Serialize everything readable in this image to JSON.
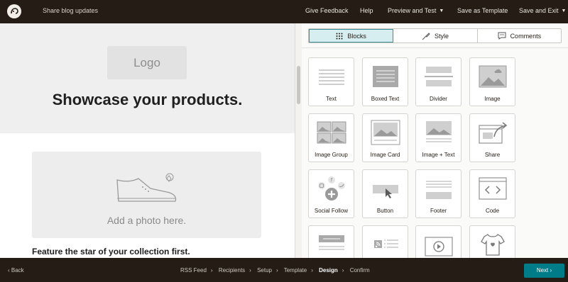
{
  "topbar": {
    "title": "Share blog updates",
    "nav": {
      "feedback": "Give Feedback",
      "help": "Help",
      "preview": "Preview and Test",
      "save_template": "Save as Template",
      "save_exit": "Save and Exit"
    }
  },
  "canvas": {
    "logo_placeholder": "Logo",
    "headline": "Showcase your products.",
    "photo_placeholder": "Add a photo here.",
    "feature_text": "Feature the star of your collection first."
  },
  "panel": {
    "tabs": [
      {
        "label": "Blocks",
        "icon": "grid-icon",
        "active": true
      },
      {
        "label": "Style",
        "icon": "brush-icon",
        "active": false
      },
      {
        "label": "Comments",
        "icon": "comment-icon",
        "active": false
      }
    ],
    "blocks": [
      {
        "label": "Text",
        "icon": "text-block-icon"
      },
      {
        "label": "Boxed Text",
        "icon": "boxed-text-icon"
      },
      {
        "label": "Divider",
        "icon": "divider-icon"
      },
      {
        "label": "Image",
        "icon": "image-icon"
      },
      {
        "label": "Image Group",
        "icon": "image-group-icon"
      },
      {
        "label": "Image Card",
        "icon": "image-card-icon"
      },
      {
        "label": "Image + Text",
        "icon": "image-text-icon"
      },
      {
        "label": "Share",
        "icon": "share-icon"
      },
      {
        "label": "Social Follow",
        "icon": "social-follow-icon"
      },
      {
        "label": "Button",
        "icon": "button-icon"
      },
      {
        "label": "Footer",
        "icon": "footer-icon"
      },
      {
        "label": "Code",
        "icon": "code-icon"
      },
      {
        "label": "",
        "icon": "rss-header-icon"
      },
      {
        "label": "",
        "icon": "rss-items-icon"
      },
      {
        "label": "",
        "icon": "video-icon"
      },
      {
        "label": "",
        "icon": "product-icon"
      }
    ]
  },
  "bottombar": {
    "back": "Back",
    "steps": [
      "RSS Feed",
      "Recipients",
      "Setup",
      "Template",
      "Design",
      "Confirm"
    ],
    "current_step": "Design",
    "next": "Next"
  },
  "colors": {
    "topbar_bg": "#241c15",
    "accent": "#007c89",
    "active_tab_bg": "#d7eef0"
  }
}
